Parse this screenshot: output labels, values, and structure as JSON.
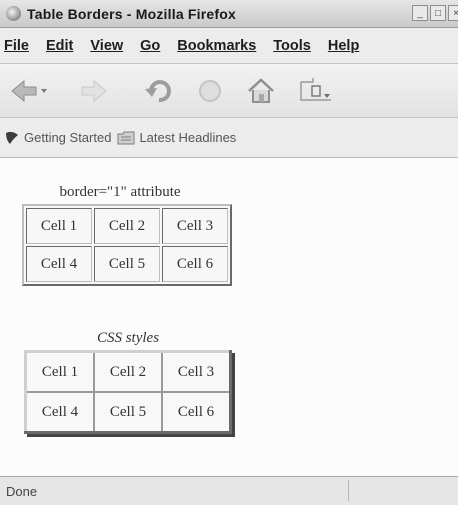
{
  "window": {
    "title": "Table Borders - Mozilla Firefox"
  },
  "menu": {
    "items": [
      "File",
      "Edit",
      "View",
      "Go",
      "Bookmarks",
      "Tools",
      "Help"
    ]
  },
  "bookmarks": {
    "items": [
      {
        "label": "Getting Started",
        "icon": "bookmark-page-icon"
      },
      {
        "label": "Latest Headlines",
        "icon": "live-bookmark-folder-icon"
      }
    ]
  },
  "content": {
    "table1": {
      "caption": "border=\"1\" attribute",
      "rows": [
        [
          "Cell 1",
          "Cell 2",
          "Cell 3"
        ],
        [
          "Cell 4",
          "Cell 5",
          "Cell 6"
        ]
      ]
    },
    "table2": {
      "caption": "CSS styles",
      "rows": [
        [
          "Cell 1",
          "Cell 2",
          "Cell 3"
        ],
        [
          "Cell 4",
          "Cell 5",
          "Cell 6"
        ]
      ]
    }
  },
  "status": {
    "text": "Done"
  },
  "icons": [
    "firefox-icon",
    "back-icon",
    "forward-icon",
    "reload-icon",
    "stop-icon",
    "home-icon",
    "address-bar-icon"
  ]
}
